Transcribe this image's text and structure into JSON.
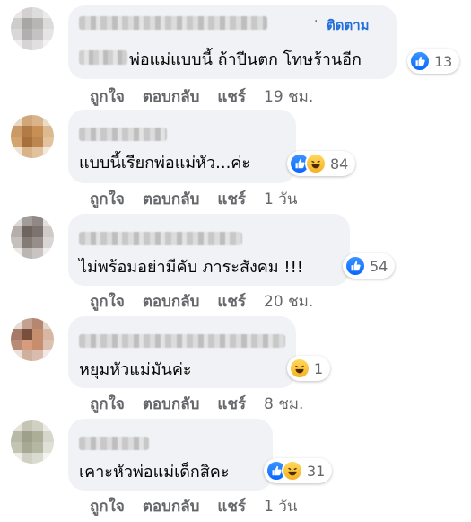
{
  "comments": [
    {
      "text": "พ่อแม่แบบนี้ ถ้าปีนตก โทษร้านอีก",
      "follow": "ติดตาม",
      "follow_sep": "·",
      "reactions": [
        "like-icon"
      ],
      "reaction_count": "13",
      "actions": {
        "like": "ถูกใจ",
        "reply": "ตอบกลับ",
        "share": "แชร์",
        "time": "19 ชม."
      }
    },
    {
      "text": "แบบนี้เรียกพ่อแม่หัว...ค่ะ",
      "reactions": [
        "like-icon",
        "haha-icon"
      ],
      "reaction_count": "84",
      "actions": {
        "like": "ถูกใจ",
        "reply": "ตอบกลับ",
        "share": "แชร์",
        "time": "1 วัน"
      }
    },
    {
      "text": "ไม่พร้อมอย่ามีคับ ภาระสังคม !!!",
      "reactions": [
        "like-icon"
      ],
      "reaction_count": "54",
      "actions": {
        "like": "ถูกใจ",
        "reply": "ตอบกลับ",
        "share": "แชร์",
        "time": "20 ชม."
      }
    },
    {
      "text": "หยุมหัวแม่มันค่ะ",
      "reactions": [
        "haha-icon"
      ],
      "reaction_count": "1",
      "actions": {
        "like": "ถูกใจ",
        "reply": "ตอบกลับ",
        "share": "แชร์",
        "time": "8 ชม."
      }
    },
    {
      "text": "เคาะหัวพ่อแม่เด็กสิคะ",
      "reactions": [
        "like-icon",
        "haha-icon"
      ],
      "reaction_count": "31",
      "actions": {
        "like": "ถูกใจ",
        "reply": "ตอบกลับ",
        "share": "แชร์",
        "time": "1 วัน"
      }
    }
  ],
  "colors": {
    "bubble": "#f0f2f5",
    "follow": "#216fdb",
    "meta": "#65676b",
    "like": "#0866ff",
    "haha": "#f7b125"
  }
}
